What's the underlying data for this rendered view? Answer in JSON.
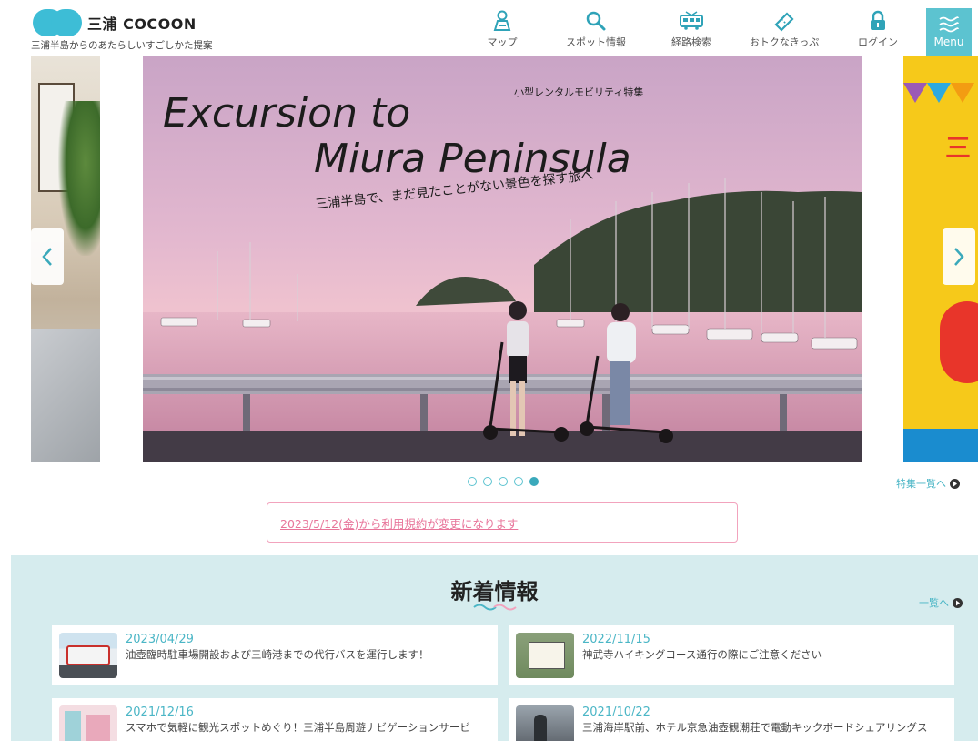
{
  "header": {
    "brand": "三浦 COCOON",
    "tagline": "三浦半島からのあたらしいすごしかた提案",
    "nav": [
      {
        "label": "マップ",
        "icon": "map-person-icon"
      },
      {
        "label": "スポット情報",
        "icon": "search-icon"
      },
      {
        "label": "経路検索",
        "icon": "train-icon"
      },
      {
        "label": "おトクなきっぷ",
        "icon": "ticket-icon"
      },
      {
        "label": "ログイン",
        "icon": "lock-icon"
      }
    ],
    "menu_label": "Menu"
  },
  "carousel": {
    "slide_title_line1": "Excursion to",
    "slide_title_line2": "Miura Peninsula",
    "slide_kicker": "小型レンタルモビリティ特集",
    "slide_subtitle": "三浦半島で、まだ見たことがない景色を探す旅へ",
    "right_slide_char": "三",
    "dots_count": 5,
    "active_dot": 5,
    "feature_link": "特集一覧へ"
  },
  "notice": {
    "text": "2023/5/12(金)から利用規約が変更になります"
  },
  "news": {
    "heading": "新着情報",
    "more_link": "一覧へ",
    "items": [
      {
        "date": "2023/04/29",
        "title": "油壺臨時駐車場開設および三崎港までの代行バスを運行します！"
      },
      {
        "date": "2022/11/15",
        "title": "神武寺ハイキングコース通行の際にご注意ください"
      },
      {
        "date": "2021/12/16",
        "title": "スマホで気軽に観光スポットめぐり！三浦半島周遊ナビゲーションサービ"
      },
      {
        "date": "2021/10/22",
        "title": "三浦海岸駅前、ホテル京急油壺観潮荘で電動キックボードシェアリングス"
      }
    ]
  },
  "colors": {
    "accent": "#5cc3d0",
    "link": "#4bb6c6",
    "notice_border": "#f2a3bd",
    "notice_text": "#e8759a",
    "news_bg": "#d6ecee"
  }
}
